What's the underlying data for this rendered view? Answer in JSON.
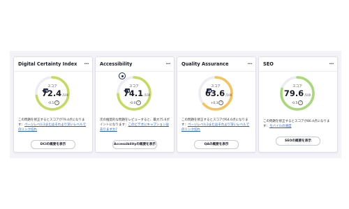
{
  "cards": [
    {
      "title": "Digital Certainty Index",
      "menu": "...",
      "score_label": "スコア",
      "score": "72.4",
      "denominator": "/100",
      "delta": "-0.1",
      "help": "?",
      "gauge_fraction": 0.724,
      "gauge_color": "#c5db5f",
      "desc_text": "この問題を修正するとスコアが79.4点になります：",
      "desc_link": "ページレベル3またはそれより深いレベルでのリンク切れ",
      "desc_after": "",
      "button": "DCIの概要を表示"
    },
    {
      "title": "Accessibility",
      "menu": "...",
      "score_label": "スコア",
      "score": "74.1",
      "denominator": "/100",
      "delta": "-0.0",
      "help": "?",
      "gauge_fraction": 0.741,
      "gauge_color": "#c5db5f",
      "desc_text": "次の推奨的な問題をレビューすると、最大75.6ポイントになります：",
      "desc_link": "このビデオにキャプションはありますか?",
      "desc_after": "",
      "button": "Accessibilityの概要を表示"
    },
    {
      "title": "Quality Assurance",
      "menu": "...",
      "score_label": "スコア",
      "score": "63.6",
      "denominator": "/100",
      "delta": "+0.3",
      "help": "?",
      "gauge_fraction": 0.636,
      "gauge_color": "#f5c25c",
      "desc_text": "この問題を修正するとスコアが64.6点になります：",
      "desc_link": "ページレベル3またはそれより深いレベルでのリンク切れ",
      "desc_after": "",
      "button": "QAの概要を表示"
    },
    {
      "title": "SEO",
      "menu": "...",
      "score_label": "スコア",
      "score": "79.6",
      "denominator": "/100",
      "delta": "-0.5",
      "help": "?",
      "gauge_fraction": 0.796,
      "gauge_color": "#a8d877",
      "desc_text": "この問題を修正するとスコアが86.4点になります：",
      "desc_link": "モバイルの速度",
      "desc_after": "",
      "button": "SEOの概要を表示"
    }
  ]
}
